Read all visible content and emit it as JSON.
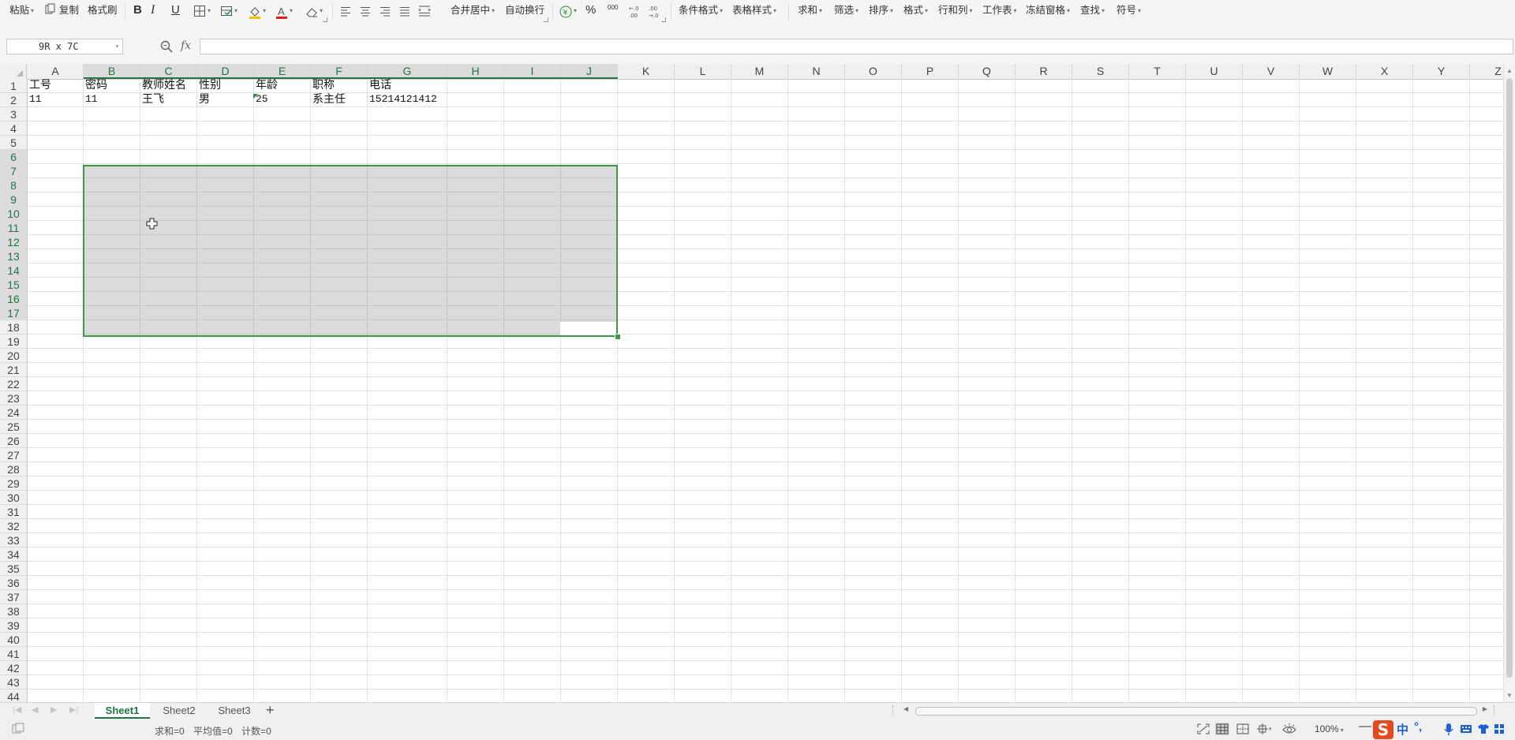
{
  "toolbar": {
    "paste": "粘贴",
    "copy": "复制",
    "format_painter": "格式刷",
    "bold": "B",
    "italic": "I",
    "underline": "U",
    "merge_center": "合并居中",
    "wrap_text": "自动换行",
    "percent": "%",
    "thousands": "000",
    "inc_decimal": "+.0 .00",
    "dec_decimal": ".00 →.0",
    "conditional_format": "条件格式",
    "table_style": "表格样式",
    "sum": "求和",
    "filter": "筛选",
    "sort": "排序",
    "format": "格式",
    "row_col": "行和列",
    "worksheet": "工作表",
    "freeze": "冻结窗格",
    "find": "查找",
    "symbol": "符号"
  },
  "formula_bar": {
    "name_box": "9R x 7C",
    "fx": "fx",
    "formula": ""
  },
  "columns": [
    "A",
    "B",
    "C",
    "D",
    "E",
    "F",
    "G",
    "H",
    "I",
    "J",
    "K",
    "L",
    "M",
    "N",
    "O",
    "P",
    "Q",
    "R",
    "S",
    "T",
    "U",
    "V",
    "W",
    "X",
    "Y",
    "Z"
  ],
  "rows": [
    "1",
    "2",
    "3",
    "4",
    "5",
    "6",
    "7",
    "8",
    "9",
    "10",
    "11",
    "12",
    "13",
    "14",
    "15",
    "16",
    "17",
    "18",
    "19",
    "20",
    "21",
    "22",
    "23",
    "24",
    "25",
    "26",
    "27",
    "28",
    "29",
    "30",
    "31",
    "32",
    "33",
    "34",
    "35",
    "36",
    "37",
    "38",
    "39",
    "40",
    "41",
    "42",
    "43",
    "44"
  ],
  "sheet": {
    "headers": [
      "工号",
      "密码",
      "教师姓名",
      "性别",
      "年龄",
      "职称",
      "电话"
    ],
    "row2": [
      "11",
      "11",
      "王飞",
      "男",
      "25",
      "系主任",
      "15214121412"
    ]
  },
  "tabs": {
    "sheet1": "Sheet1",
    "sheet2": "Sheet2",
    "sheet3": "Sheet3",
    "add": "+"
  },
  "status": {
    "sum": "求和=0",
    "average": "平均值=0",
    "count": "计数=0",
    "zoom": "100%",
    "ime_logo": "S",
    "ime_lang": "中",
    "ime_punct": "°,"
  },
  "colors": {
    "accent": "#217346",
    "selection_border": "#3f9a48",
    "ime_brand": "#e6481f"
  }
}
